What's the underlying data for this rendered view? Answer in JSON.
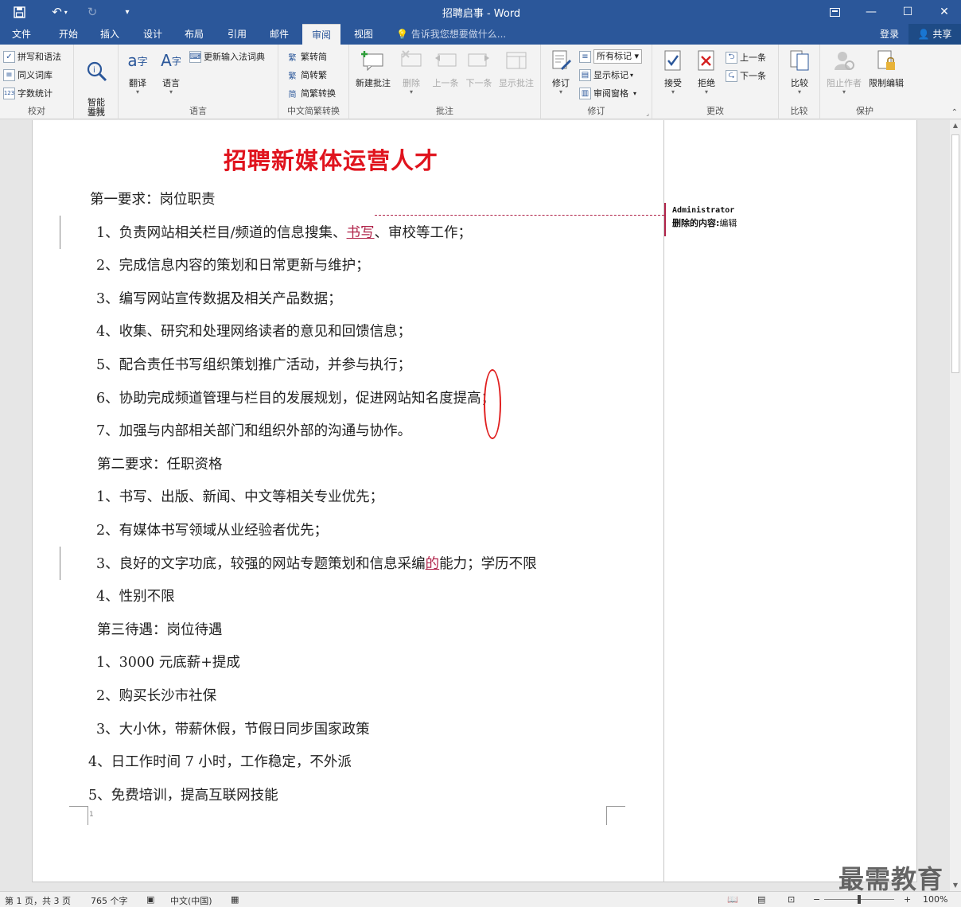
{
  "window": {
    "doc_title": "招聘启事 - Word",
    "save_icon": "save-icon",
    "undo_icon": "undo-icon",
    "redo_icon": "redo-icon",
    "restore_ribbon_icon": "ribbon-display-icon",
    "minimize": "—",
    "maximize": "☐",
    "close": "✕"
  },
  "tabs": [
    "文件",
    "开始",
    "插入",
    "设计",
    "布局",
    "引用",
    "邮件",
    "审阅",
    "视图"
  ],
  "active_tab": "审阅",
  "tell_me": "告诉我您想要做什么...",
  "login": "登录",
  "share": "共享",
  "ribbon": {
    "proofing": {
      "label": "校对",
      "spelling": "拼写和语法",
      "thesaurus": "同义词库",
      "word_count": "字数统计"
    },
    "insights": {
      "label": "见解",
      "smart_lookup": "智能\n查找"
    },
    "language": {
      "label": "语言",
      "translate": "翻译",
      "language": "语言",
      "update_ime": "更新输入法词典"
    },
    "chinese_conversion": {
      "label": "中文简繁转换",
      "to_simplified": "繁转简",
      "to_traditional": "简转繁",
      "convert": "简繁转换"
    },
    "comments": {
      "label": "批注",
      "new": "新建批注",
      "delete": "删除",
      "previous": "上一条",
      "next": "下一条",
      "show": "显示批注"
    },
    "tracking": {
      "label": "修订",
      "track_changes": "修订",
      "markup_select": "所有标记",
      "show_markup": "显示标记",
      "reviewing_pane": "审阅窗格"
    },
    "changes": {
      "label": "更改",
      "accept": "接受",
      "reject": "拒绝",
      "previous": "上一条",
      "next": "下一条"
    },
    "compare": {
      "label": "比较",
      "compare": "比较"
    },
    "protect": {
      "label": "保护",
      "block_authors": "阻止作者",
      "restrict_editing": "限制编辑"
    }
  },
  "document": {
    "heading": "招聘新媒体运营人才",
    "lines": [
      {
        "pre": "第一要求：岗位职责",
        "ins": "",
        "post": ""
      },
      {
        "pre": "1、负责网站相关栏目/频道的信息搜集、",
        "ins": "书写",
        "post": "、审校等工作；"
      },
      {
        "pre": "2、完成信息内容的策划和日常更新与维护；",
        "ins": "",
        "post": ""
      },
      {
        "pre": "3、编写网站宣传数据及相关产品数据；",
        "ins": "",
        "post": ""
      },
      {
        "pre": "4、收集、研究和处理网络读者的意见和回馈信息；",
        "ins": "",
        "post": ""
      },
      {
        "pre": "5、配合责任书写组织策划推广活动，并参与执行；",
        "ins": "",
        "post": ""
      },
      {
        "pre": "6、协助完成频道管理与栏目的发展规划，促进网站知名度提高；",
        "ins": "",
        "post": ""
      },
      {
        "pre": "7、加强与内部相关部门和组织外部的沟通与协作。",
        "ins": "",
        "post": ""
      },
      {
        "pre": "第二要求：任职资格",
        "ins": "",
        "post": ""
      },
      {
        "pre": "1、书写、出版、新闻、中文等相关专业优先；",
        "ins": "",
        "post": ""
      },
      {
        "pre": "2、有媒体书写领域从业经验者优先；",
        "ins": "",
        "post": ""
      },
      {
        "pre": "3、良好的文字功底，较强的网站专题策划和信息采编",
        "ins": "的",
        "post": "能力；学历不限"
      },
      {
        "pre": "4、性别不限",
        "ins": "",
        "post": ""
      },
      {
        "pre": "第三待遇：岗位待遇",
        "ins": "",
        "post": ""
      },
      {
        "pre": "1、3000 元底薪+提成",
        "ins": "",
        "post": ""
      },
      {
        "pre": "2、购买长沙市社保",
        "ins": "",
        "post": ""
      },
      {
        "pre": "3、大小休，带薪休假，节假日同步国家政策",
        "ins": "",
        "post": ""
      },
      {
        "pre": "4、日工作时间 7 小时，工作稳定，不外派",
        "ins": "",
        "post": ""
      },
      {
        "pre": "5、免费培训，提高互联网技能",
        "ins": "",
        "post": ""
      }
    ],
    "page_marker": "1"
  },
  "balloon": {
    "author": "Administrator",
    "kind": "删除的内容:",
    "text": "编辑"
  },
  "status": {
    "page": "第 1 页，共 3 页",
    "words": "765 个字",
    "language": "中文(中国)",
    "zoom": "100%"
  },
  "watermark": "最需教育",
  "colors": {
    "ribbon_blue": "#2b579a",
    "heading_red": "#e0141e",
    "revision": "#b0244a"
  }
}
